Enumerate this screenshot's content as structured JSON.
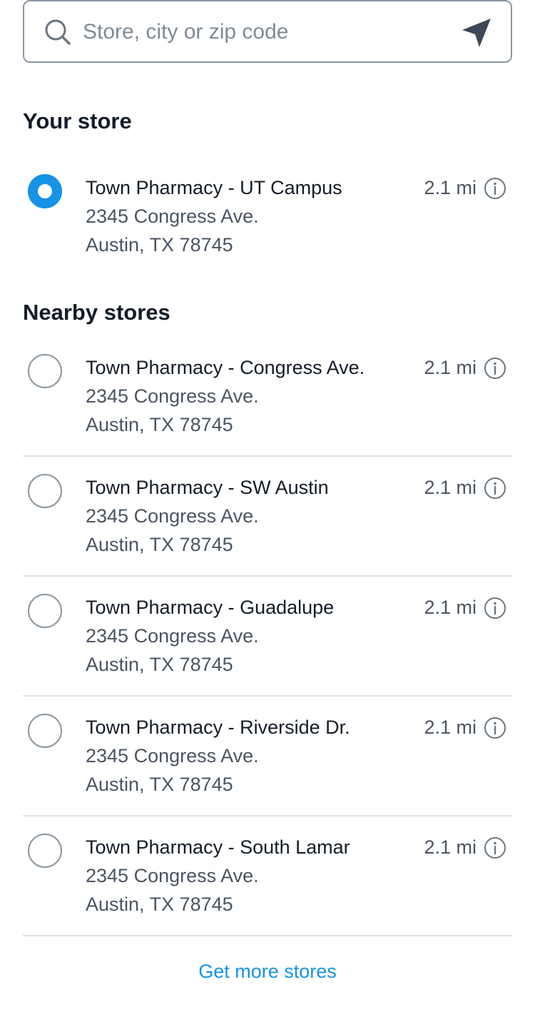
{
  "search": {
    "placeholder": "Store, city or zip code",
    "value": ""
  },
  "your_store": {
    "title": "Your store",
    "store": {
      "name": "Town Pharmacy - UT Campus",
      "address1": "2345 Congress Ave.",
      "address2": "Austin, TX 78745",
      "distance": "2.1 mi",
      "selected": true
    }
  },
  "nearby": {
    "title": "Nearby stores",
    "stores": [
      {
        "name": "Town Pharmacy - Congress Ave.",
        "address1": "2345 Congress Ave.",
        "address2": "Austin, TX 78745",
        "distance": "2.1 mi"
      },
      {
        "name": "Town Pharmacy - SW Austin",
        "address1": "2345 Congress Ave.",
        "address2": "Austin, TX 78745",
        "distance": "2.1 mi"
      },
      {
        "name": "Town Pharmacy - Guadalupe",
        "address1": "2345 Congress Ave.",
        "address2": "Austin, TX 78745",
        "distance": "2.1 mi"
      },
      {
        "name": "Town Pharmacy - Riverside Dr.",
        "address1": "2345 Congress Ave.",
        "address2": "Austin, TX 78745",
        "distance": "2.1 mi"
      },
      {
        "name": "Town Pharmacy - South Lamar",
        "address1": "2345 Congress Ave.",
        "address2": "Austin, TX 78745",
        "distance": "2.1 mi"
      }
    ]
  },
  "more_link": "Get more stores",
  "colors": {
    "accent": "#1692e6",
    "text": "#141c28",
    "muted": "#4a5563",
    "divider": "#dde3ea"
  }
}
